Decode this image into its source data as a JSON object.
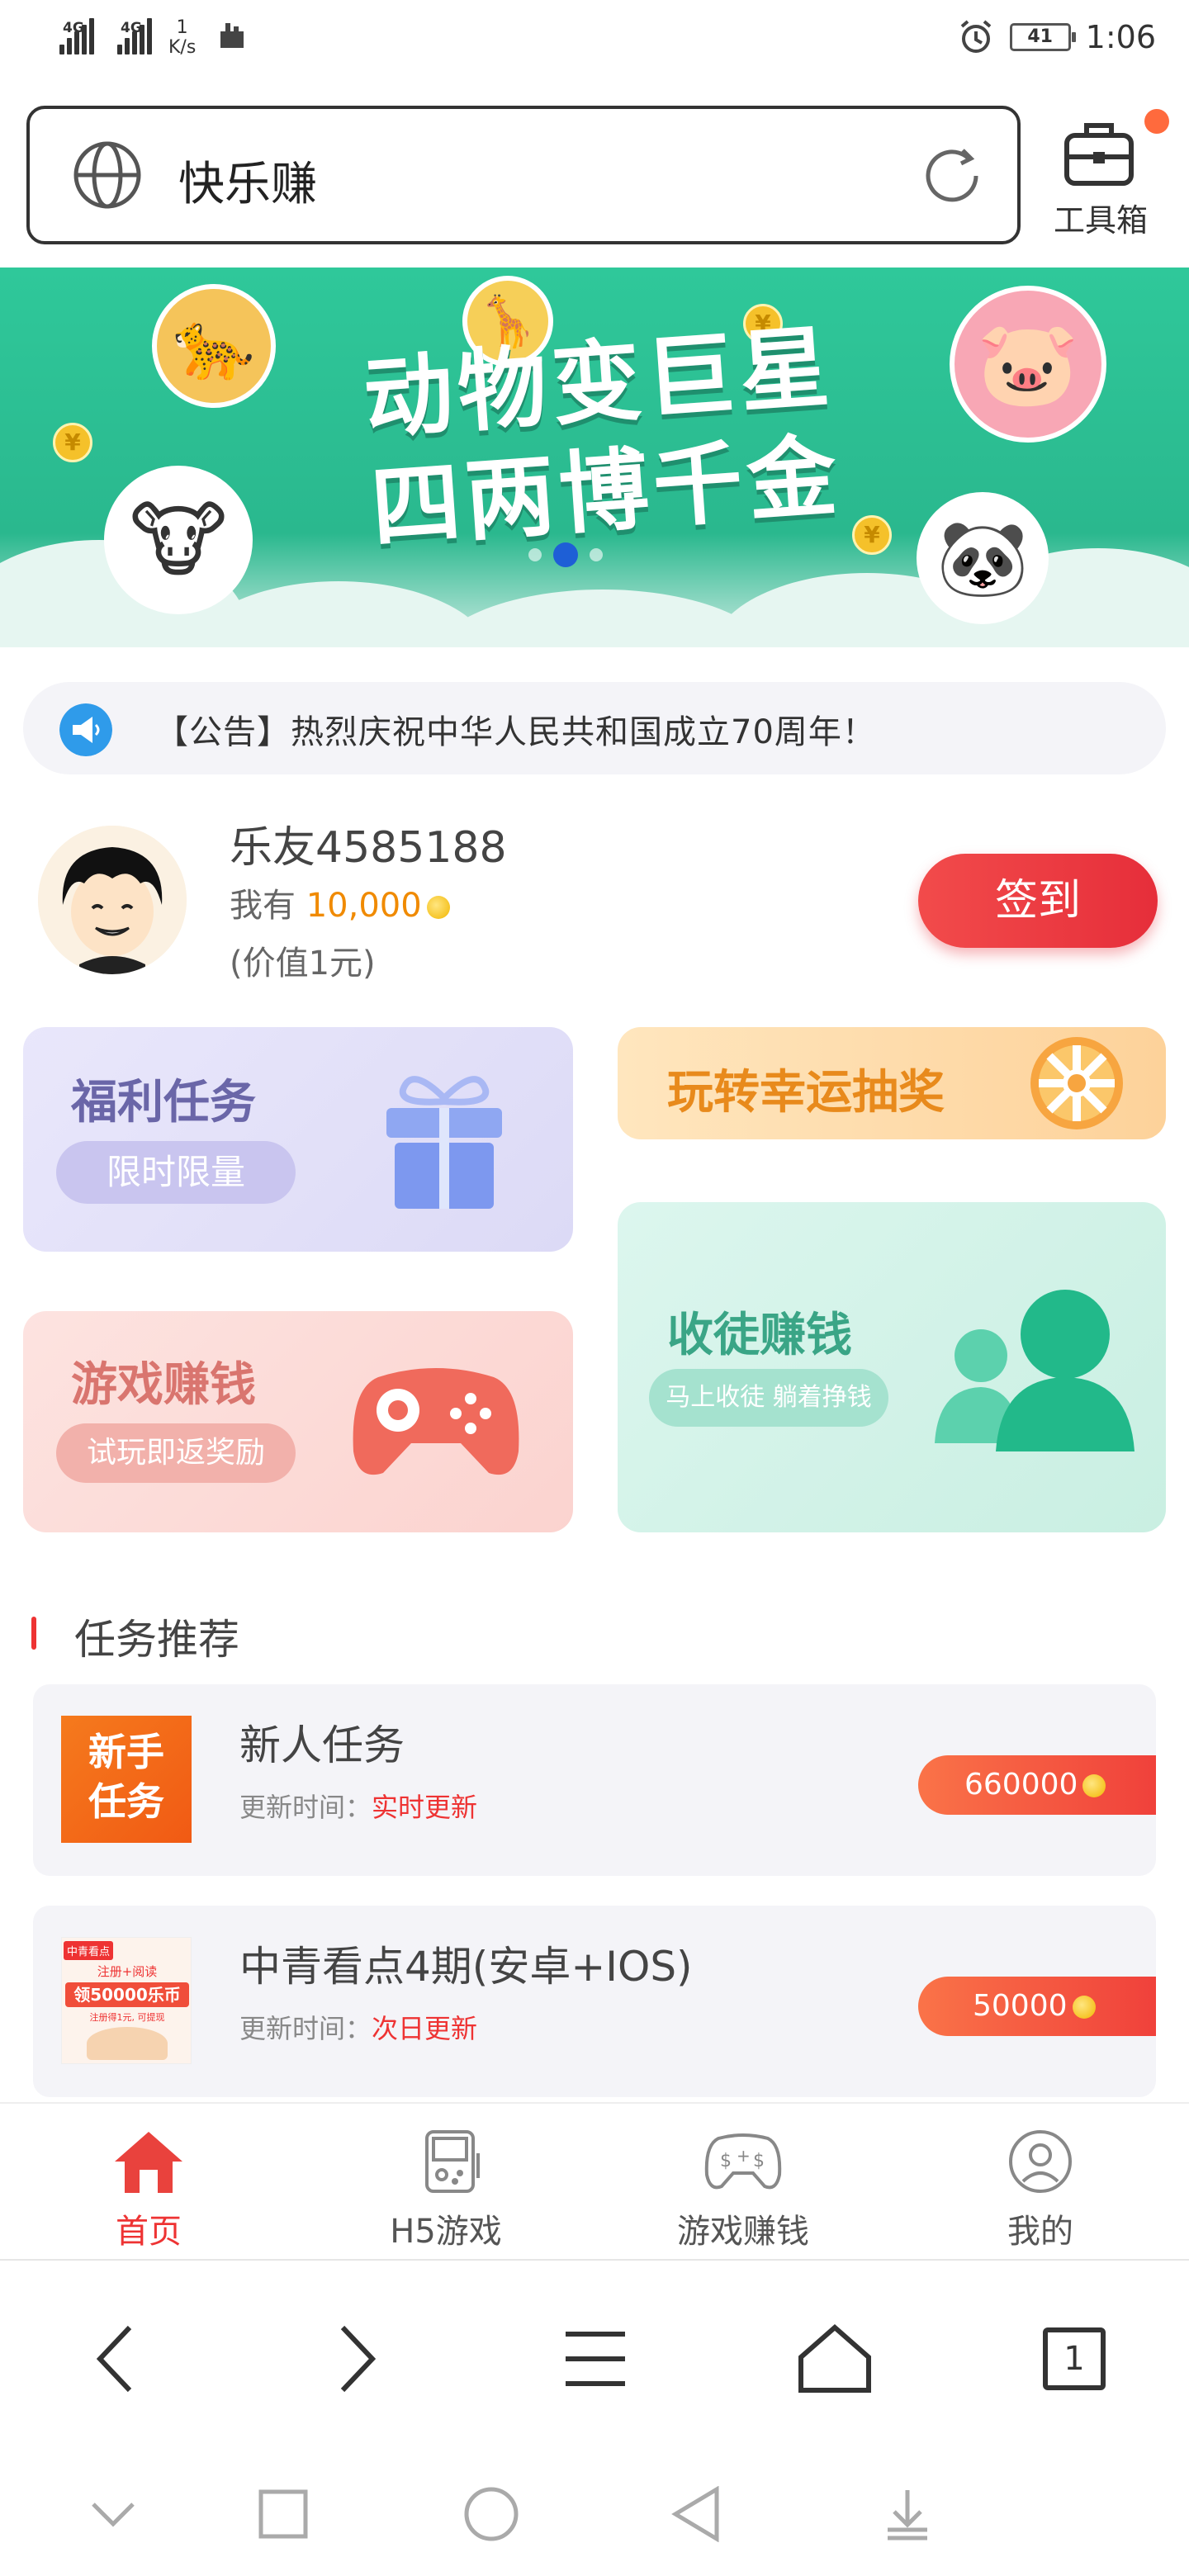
{
  "status_bar": {
    "signal1": "4G",
    "signal2": "4G",
    "speed_value": "1",
    "speed_unit": "K/s",
    "battery": "41",
    "time": "1:06"
  },
  "search": {
    "value": "快乐赚"
  },
  "toolbox": {
    "label": "工具箱"
  },
  "banner": {
    "title_line1": "动物变巨星",
    "title_line2": "四两博千金",
    "coin_symbol": "¥"
  },
  "notice": {
    "text": "【公告】热烈庆祝中华人民共和国成立70周年！"
  },
  "user": {
    "name": "乐友4585188",
    "balance_prefix": "我有",
    "balance": "10,000",
    "worth": "(价值1元)",
    "signin_label": "签到"
  },
  "cards": {
    "welfare": {
      "title": "福利任务",
      "tag": "限时限量"
    },
    "lottery": {
      "title": "玩转幸运抽奖"
    },
    "game": {
      "title": "游戏赚钱",
      "tag": "试玩即返奖励"
    },
    "disciple": {
      "title": "收徒赚钱",
      "tag": "马上收徒 躺着挣钱"
    }
  },
  "section": {
    "title": "任务推荐"
  },
  "tasks": [
    {
      "name": "新人任务",
      "update_label": "更新时间：",
      "update_value": "实时更新",
      "reward": "660000",
      "thumb_line1": "新手",
      "thumb_line2": "任务"
    },
    {
      "name": "中青看点4期(安卓+IOS)",
      "update_label": "更新时间：",
      "update_value": "次日更新",
      "reward": "50000",
      "thumb_badge": "中青看点",
      "thumb_sub": "注册+阅读",
      "thumb_big": "领50000乐币",
      "thumb_small": "注册得1元, 可提现"
    }
  ],
  "bottom_nav": [
    {
      "label": "首页",
      "icon": "home-icon",
      "active": true
    },
    {
      "label": "H5游戏",
      "icon": "gameboy-icon",
      "active": false
    },
    {
      "label": "游戏赚钱",
      "icon": "gamepad-icon",
      "active": false
    },
    {
      "label": "我的",
      "icon": "profile-icon",
      "active": false
    }
  ],
  "browser": {
    "tab_count": "1"
  },
  "colors": {
    "accent": "#e33333",
    "primary_green": "#2fc89a",
    "coin": "#f2b600"
  }
}
